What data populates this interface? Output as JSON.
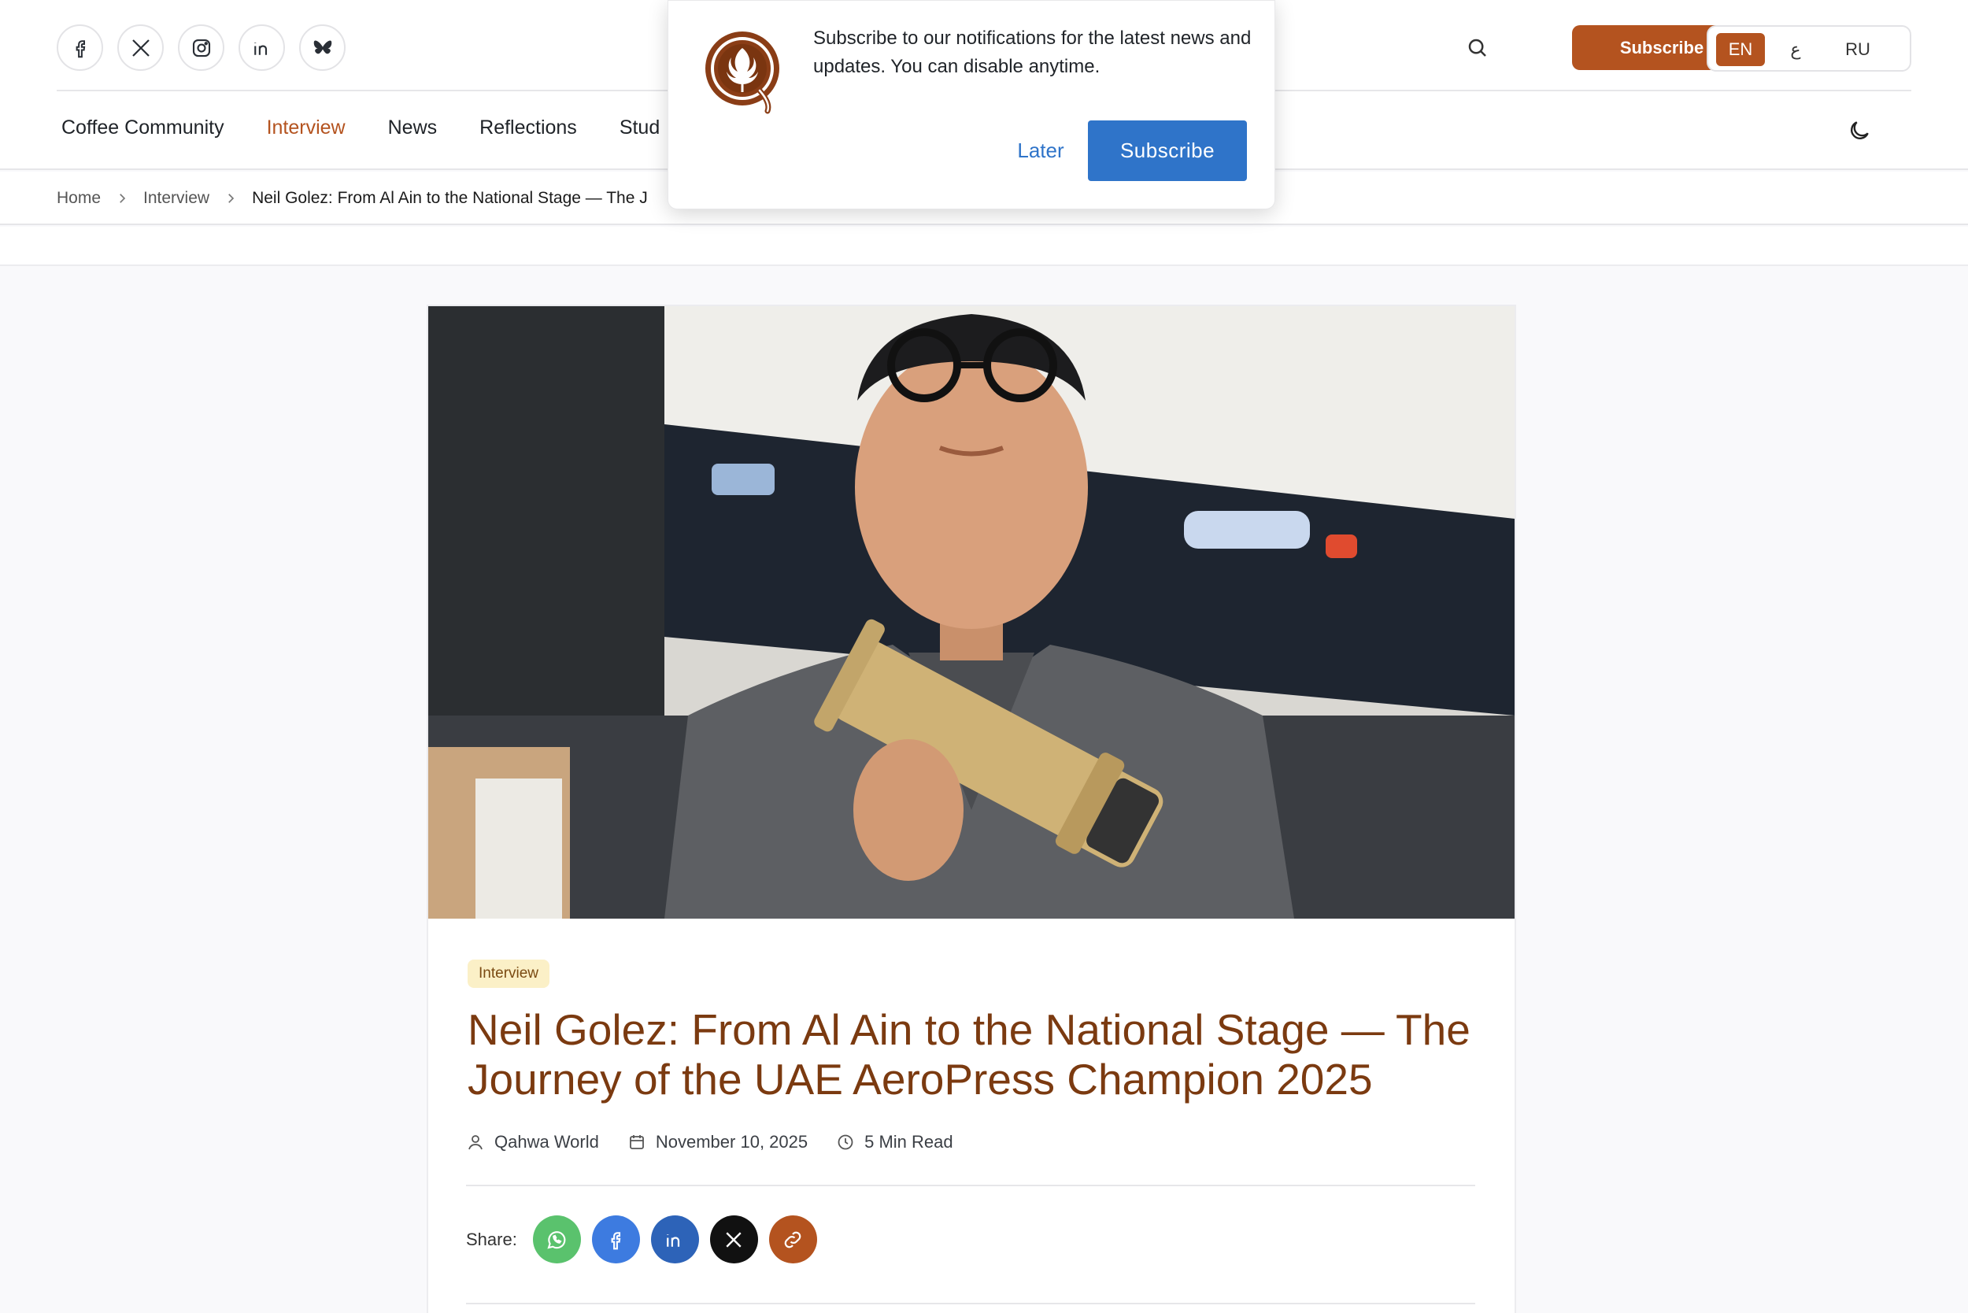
{
  "socials": [
    "facebook-icon",
    "x-icon",
    "instagram-icon",
    "linkedin-icon",
    "bluesky-icon"
  ],
  "header": {
    "subscribe_label": "Subscribe",
    "languages": [
      "EN",
      "ع",
      "RU"
    ],
    "active_language": "EN"
  },
  "nav": {
    "items": [
      "Coffee Community",
      "Interview",
      "News",
      "Reflections",
      "Stud"
    ],
    "active": "Interview"
  },
  "breadcrumb": {
    "home": "Home",
    "section": "Interview",
    "current": "Neil Golez: From Al Ain to the National Stage — The J"
  },
  "article": {
    "tag": "Interview",
    "title": "Neil Golez: From Al Ain to the National Stage — The Journey of the UAE AeroPress Champion 2025",
    "author": "Qahwa World",
    "date": "November 10, 2025",
    "read_time": "5 Min Read",
    "share_label": "Share:",
    "share_buttons": [
      "whatsapp-icon",
      "facebook-icon",
      "linkedin-icon",
      "x-icon",
      "link-icon"
    ]
  },
  "popup": {
    "message": "Subscribe to our notifications for the latest news and updates. You can disable anytime.",
    "later_label": "Later",
    "subscribe_label": "Subscribe"
  },
  "colors": {
    "brand": "#b4531f",
    "title": "#7b3a10",
    "popup_button": "#2f74c9",
    "whatsapp": "#5ac26d",
    "facebook": "#3d7be0",
    "linkedin": "#2d63b8",
    "x": "#111111",
    "link": "#b4531f"
  }
}
